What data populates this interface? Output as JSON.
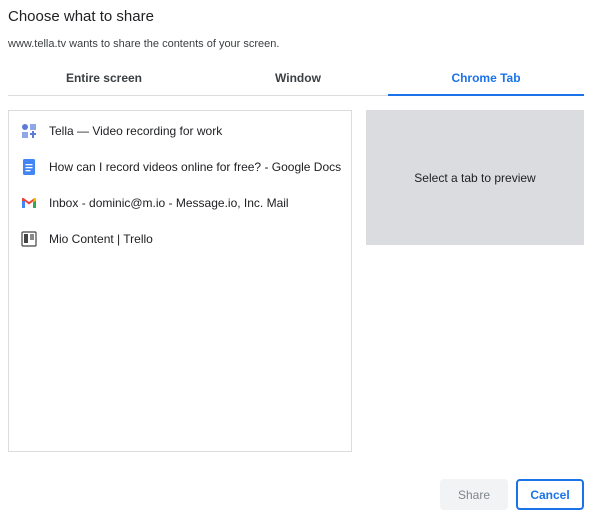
{
  "dialog": {
    "title": "Choose what to share",
    "subtitle": "www.tella.tv wants to share the contents of your screen."
  },
  "tabs": [
    {
      "label": "Entire screen",
      "selected": false
    },
    {
      "label": "Window",
      "selected": false
    },
    {
      "label": "Chrome Tab",
      "selected": true
    }
  ],
  "tab_list": [
    {
      "title": "Tella — Video recording for work",
      "icon": "tella-icon"
    },
    {
      "title": "How can I record videos online for free? - Google Docs",
      "icon": "google-docs-icon"
    },
    {
      "title": "Inbox - dominic@m.io - Message.io, Inc. Mail",
      "icon": "gmail-icon"
    },
    {
      "title": "Mio Content | Trello",
      "icon": "trello-icon"
    }
  ],
  "preview": {
    "placeholder": "Select a tab to preview"
  },
  "buttons": {
    "share_label": "Share",
    "cancel_label": "Cancel"
  },
  "colors": {
    "accent": "#1a73e8",
    "preview_bg": "#dadce0",
    "disabled_button_bg": "#f1f3f4"
  }
}
